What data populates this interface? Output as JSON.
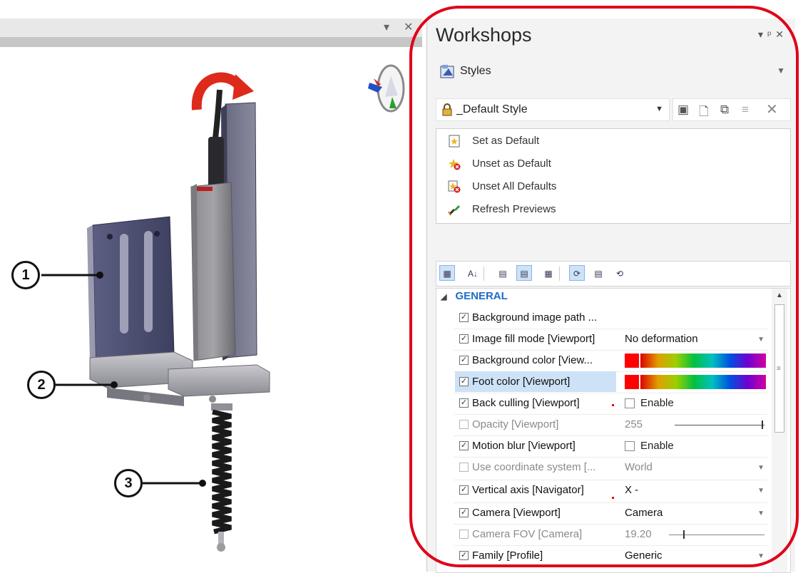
{
  "viewport": {
    "callouts": [
      "1",
      "2",
      "3"
    ]
  },
  "panel": {
    "title": "Workshops",
    "styles_header": "Styles",
    "style_combo": {
      "value": "_Default Style"
    },
    "actions": [
      "Set as Default",
      "Unset as Default",
      "Unset All Defaults",
      "Refresh Previews"
    ],
    "category": "GENERAL",
    "rows": [
      {
        "name": "Background image path ...",
        "checked": true,
        "enabled": true
      },
      {
        "name": "Image fill mode [Viewport]",
        "checked": true,
        "enabled": true,
        "value": "No deformation"
      },
      {
        "name": "Background color [View...",
        "checked": true,
        "enabled": true,
        "value_color": "#ff0000"
      },
      {
        "name": "Foot color [Viewport]",
        "checked": true,
        "enabled": true,
        "selected": true,
        "value_color": "#ff0000"
      },
      {
        "name": "Back culling [Viewport]",
        "checked": true,
        "enabled": true,
        "value": "Enable"
      },
      {
        "name": "Opacity [Viewport]",
        "checked": false,
        "enabled": false,
        "value": "255"
      },
      {
        "name": "Motion blur [Viewport]",
        "checked": true,
        "enabled": true,
        "value": "Enable"
      },
      {
        "name": "Use coordinate system [...",
        "checked": false,
        "enabled": false,
        "value": "World"
      },
      {
        "name": "Vertical axis [Navigator]",
        "checked": true,
        "enabled": true,
        "value": "X -"
      },
      {
        "name": "Camera [Viewport]",
        "checked": true,
        "enabled": true,
        "value": "Camera"
      },
      {
        "name": "Camera FOV [Camera]",
        "checked": false,
        "enabled": false,
        "value": "19.20"
      },
      {
        "name": "Family [Profile]",
        "checked": true,
        "enabled": true,
        "value": "Generic"
      }
    ]
  },
  "colors": {
    "highlight": "#e00019",
    "category_text": "#1e6cc7",
    "selection": "#cde2f6"
  }
}
